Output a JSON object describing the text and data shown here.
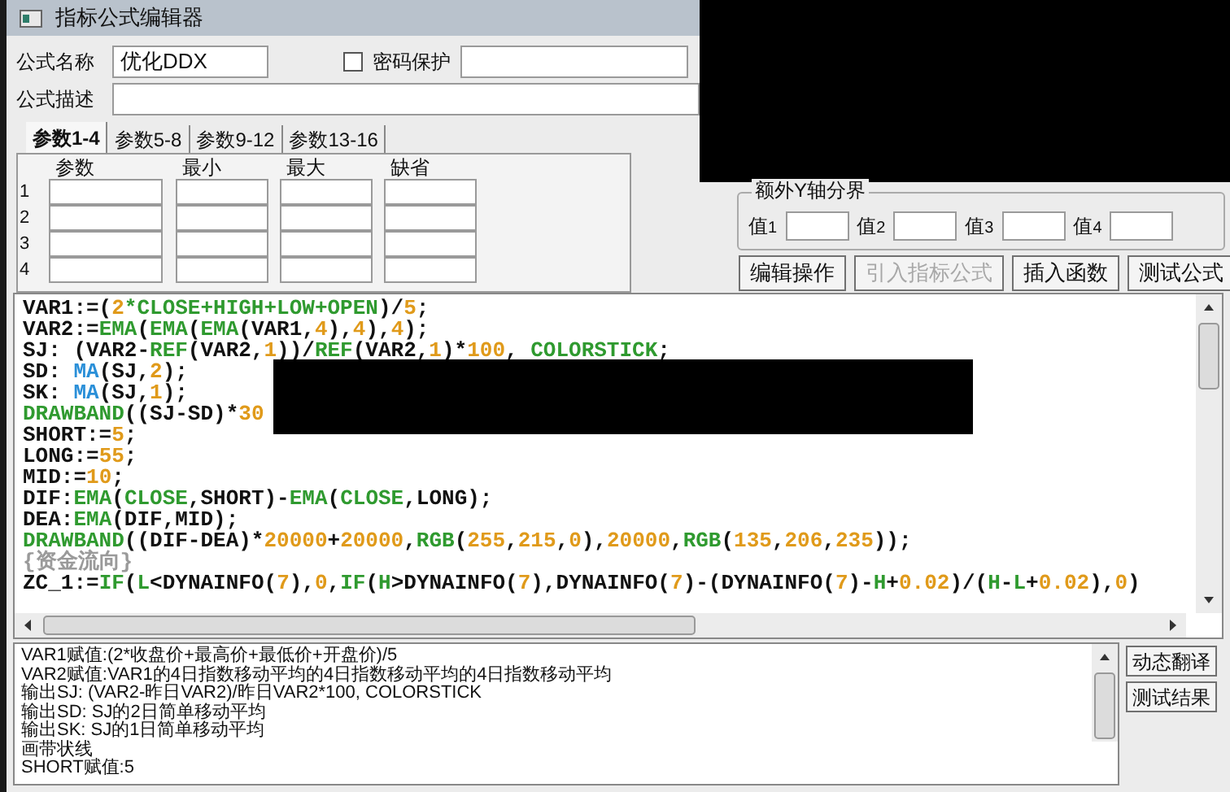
{
  "window": {
    "title": "指标公式编辑器"
  },
  "formula_name": {
    "label": "公式名称",
    "value": "优化DDX"
  },
  "password": {
    "label": "密码保护",
    "checked": false
  },
  "description": {
    "label": "公式描述"
  },
  "tabs": [
    {
      "label": "参数1-4",
      "selected": true
    },
    {
      "label": "参数5-8",
      "selected": false
    },
    {
      "label": "参数9-12",
      "selected": false
    },
    {
      "label": "参数13-16",
      "selected": false
    }
  ],
  "params": {
    "columns": [
      "参数",
      "最小",
      "最大",
      "缺省"
    ],
    "rows": [
      "1",
      "2",
      "3",
      "4"
    ]
  },
  "y_axis": {
    "title": "额外Y轴分界",
    "fields": [
      {
        "label": "值",
        "index": "1"
      },
      {
        "label": "值",
        "index": "2"
      },
      {
        "label": "值",
        "index": "3"
      },
      {
        "label": "值",
        "index": "4"
      }
    ]
  },
  "buttons": [
    {
      "label": "编辑操作",
      "disabled": false
    },
    {
      "label": "引入指标公式",
      "disabled": true
    },
    {
      "label": "插入函数",
      "disabled": false
    },
    {
      "label": "测试公式",
      "disabled": false
    }
  ],
  "code_lines": [
    [
      {
        "kind": "text",
        "text": "VAR1:=("
      },
      {
        "kind": "number",
        "text": "2"
      },
      {
        "kind": "func",
        "text": "*CLOSE+HIGH+LOW+OPEN"
      },
      {
        "kind": "text",
        "text": ")/"
      },
      {
        "kind": "number",
        "text": "5"
      },
      {
        "kind": "text",
        "text": ";"
      }
    ],
    [
      {
        "kind": "text",
        "text": "VAR2:="
      },
      {
        "kind": "func",
        "text": "EMA"
      },
      {
        "kind": "text",
        "text": "("
      },
      {
        "kind": "func",
        "text": "EMA"
      },
      {
        "kind": "text",
        "text": "("
      },
      {
        "kind": "func",
        "text": "EMA"
      },
      {
        "kind": "text",
        "text": "(VAR1,"
      },
      {
        "kind": "number",
        "text": "4"
      },
      {
        "kind": "text",
        "text": "),"
      },
      {
        "kind": "number",
        "text": "4"
      },
      {
        "kind": "text",
        "text": "),"
      },
      {
        "kind": "number",
        "text": "4"
      },
      {
        "kind": "text",
        "text": ");"
      }
    ],
    [
      {
        "kind": "text",
        "text": "SJ: (VAR2-"
      },
      {
        "kind": "func",
        "text": "REF"
      },
      {
        "kind": "text",
        "text": "(VAR2,"
      },
      {
        "kind": "number",
        "text": "1"
      },
      {
        "kind": "text",
        "text": "))/"
      },
      {
        "kind": "func",
        "text": "REF"
      },
      {
        "kind": "text",
        "text": "(VAR2,"
      },
      {
        "kind": "number",
        "text": "1"
      },
      {
        "kind": "text",
        "text": ")*"
      },
      {
        "kind": "number",
        "text": "100"
      },
      {
        "kind": "text",
        "text": ", "
      },
      {
        "kind": "func",
        "text": "COLORSTICK"
      },
      {
        "kind": "text",
        "text": ";"
      }
    ],
    [
      {
        "kind": "text",
        "text": "SD: "
      },
      {
        "kind": "ma",
        "text": "MA"
      },
      {
        "kind": "text",
        "text": "(SJ,"
      },
      {
        "kind": "number",
        "text": "2"
      },
      {
        "kind": "text",
        "text": ");"
      }
    ],
    [
      {
        "kind": "text",
        "text": "SK: "
      },
      {
        "kind": "ma",
        "text": "MA"
      },
      {
        "kind": "text",
        "text": "(SJ,"
      },
      {
        "kind": "number",
        "text": "1"
      },
      {
        "kind": "text",
        "text": ");"
      }
    ],
    [
      {
        "kind": "func",
        "text": "DRAWBAND"
      },
      {
        "kind": "text",
        "text": "((SJ-SD)*"
      },
      {
        "kind": "number",
        "text": "30"
      }
    ],
    [
      {
        "kind": "text",
        "text": "SHORT:="
      },
      {
        "kind": "number",
        "text": "5"
      },
      {
        "kind": "text",
        "text": ";"
      }
    ],
    [
      {
        "kind": "text",
        "text": "LONG:="
      },
      {
        "kind": "number",
        "text": "55"
      },
      {
        "kind": "text",
        "text": ";"
      }
    ],
    [
      {
        "kind": "text",
        "text": "MID:="
      },
      {
        "kind": "number",
        "text": "10"
      },
      {
        "kind": "text",
        "text": ";"
      }
    ],
    [
      {
        "kind": "text",
        "text": "DIF:"
      },
      {
        "kind": "func",
        "text": "EMA"
      },
      {
        "kind": "text",
        "text": "("
      },
      {
        "kind": "func",
        "text": "CLOSE"
      },
      {
        "kind": "text",
        "text": ",SHORT)-"
      },
      {
        "kind": "func",
        "text": "EMA"
      },
      {
        "kind": "text",
        "text": "("
      },
      {
        "kind": "func",
        "text": "CLOSE"
      },
      {
        "kind": "text",
        "text": ",LONG);"
      }
    ],
    [
      {
        "kind": "text",
        "text": "DEA:"
      },
      {
        "kind": "func",
        "text": "EMA"
      },
      {
        "kind": "text",
        "text": "(DIF,MID);"
      }
    ],
    [
      {
        "kind": "func",
        "text": "DRAWBAND"
      },
      {
        "kind": "text",
        "text": "((DIF-DEA)*"
      },
      {
        "kind": "number",
        "text": "20000"
      },
      {
        "kind": "text",
        "text": "+"
      },
      {
        "kind": "number",
        "text": "20000"
      },
      {
        "kind": "text",
        "text": ","
      },
      {
        "kind": "func",
        "text": "RGB"
      },
      {
        "kind": "text",
        "text": "("
      },
      {
        "kind": "number",
        "text": "255"
      },
      {
        "kind": "text",
        "text": ","
      },
      {
        "kind": "number",
        "text": "215"
      },
      {
        "kind": "text",
        "text": ","
      },
      {
        "kind": "number",
        "text": "0"
      },
      {
        "kind": "text",
        "text": "),"
      },
      {
        "kind": "number",
        "text": "20000"
      },
      {
        "kind": "text",
        "text": ","
      },
      {
        "kind": "func",
        "text": "RGB"
      },
      {
        "kind": "text",
        "text": "("
      },
      {
        "kind": "number",
        "text": "135"
      },
      {
        "kind": "text",
        "text": ","
      },
      {
        "kind": "number",
        "text": "206"
      },
      {
        "kind": "text",
        "text": ","
      },
      {
        "kind": "number",
        "text": "235"
      },
      {
        "kind": "text",
        "text": "));"
      }
    ],
    [
      {
        "kind": "comment",
        "text": "{资金流向}"
      }
    ],
    [
      {
        "kind": "text",
        "text": "ZC_1:="
      },
      {
        "kind": "func",
        "text": "IF"
      },
      {
        "kind": "text",
        "text": "("
      },
      {
        "kind": "func",
        "text": "L"
      },
      {
        "kind": "text",
        "text": "<DYNAINFO("
      },
      {
        "kind": "number",
        "text": "7"
      },
      {
        "kind": "text",
        "text": "),"
      },
      {
        "kind": "number",
        "text": "0"
      },
      {
        "kind": "text",
        "text": ","
      },
      {
        "kind": "func",
        "text": "IF"
      },
      {
        "kind": "text",
        "text": "("
      },
      {
        "kind": "func",
        "text": "H"
      },
      {
        "kind": "text",
        "text": ">DYNAINFO("
      },
      {
        "kind": "number",
        "text": "7"
      },
      {
        "kind": "text",
        "text": "),DYNAINFO("
      },
      {
        "kind": "number",
        "text": "7"
      },
      {
        "kind": "text",
        "text": ")-(DYNAINFO("
      },
      {
        "kind": "number",
        "text": "7"
      },
      {
        "kind": "text",
        "text": ")-"
      },
      {
        "kind": "func",
        "text": "H"
      },
      {
        "kind": "text",
        "text": "+"
      },
      {
        "kind": "number",
        "text": "0.02"
      },
      {
        "kind": "text",
        "text": ")/("
      },
      {
        "kind": "func",
        "text": "H"
      },
      {
        "kind": "text",
        "text": "-"
      },
      {
        "kind": "func",
        "text": "L"
      },
      {
        "kind": "text",
        "text": "+"
      },
      {
        "kind": "number",
        "text": "0.02"
      },
      {
        "kind": "text",
        "text": "),"
      },
      {
        "kind": "number",
        "text": "0"
      },
      {
        "kind": "text",
        "text": ")"
      }
    ]
  ],
  "output_lines": [
    "VAR1赋值:(2*收盘价+最高价+最低价+开盘价)/5",
    "VAR2赋值:VAR1的4日指数移动平均的4日指数移动平均的4日指数移动平均",
    "输出SJ: (VAR2-昨日VAR2)/昨日VAR2*100, COLORSTICK",
    "输出SD: SJ的2日简单移动平均",
    "输出SK: SJ的1日简单移动平均",
    "画带状线",
    "SHORT赋值:5"
  ],
  "side_buttons": [
    "动态翻译",
    "测试结果"
  ]
}
